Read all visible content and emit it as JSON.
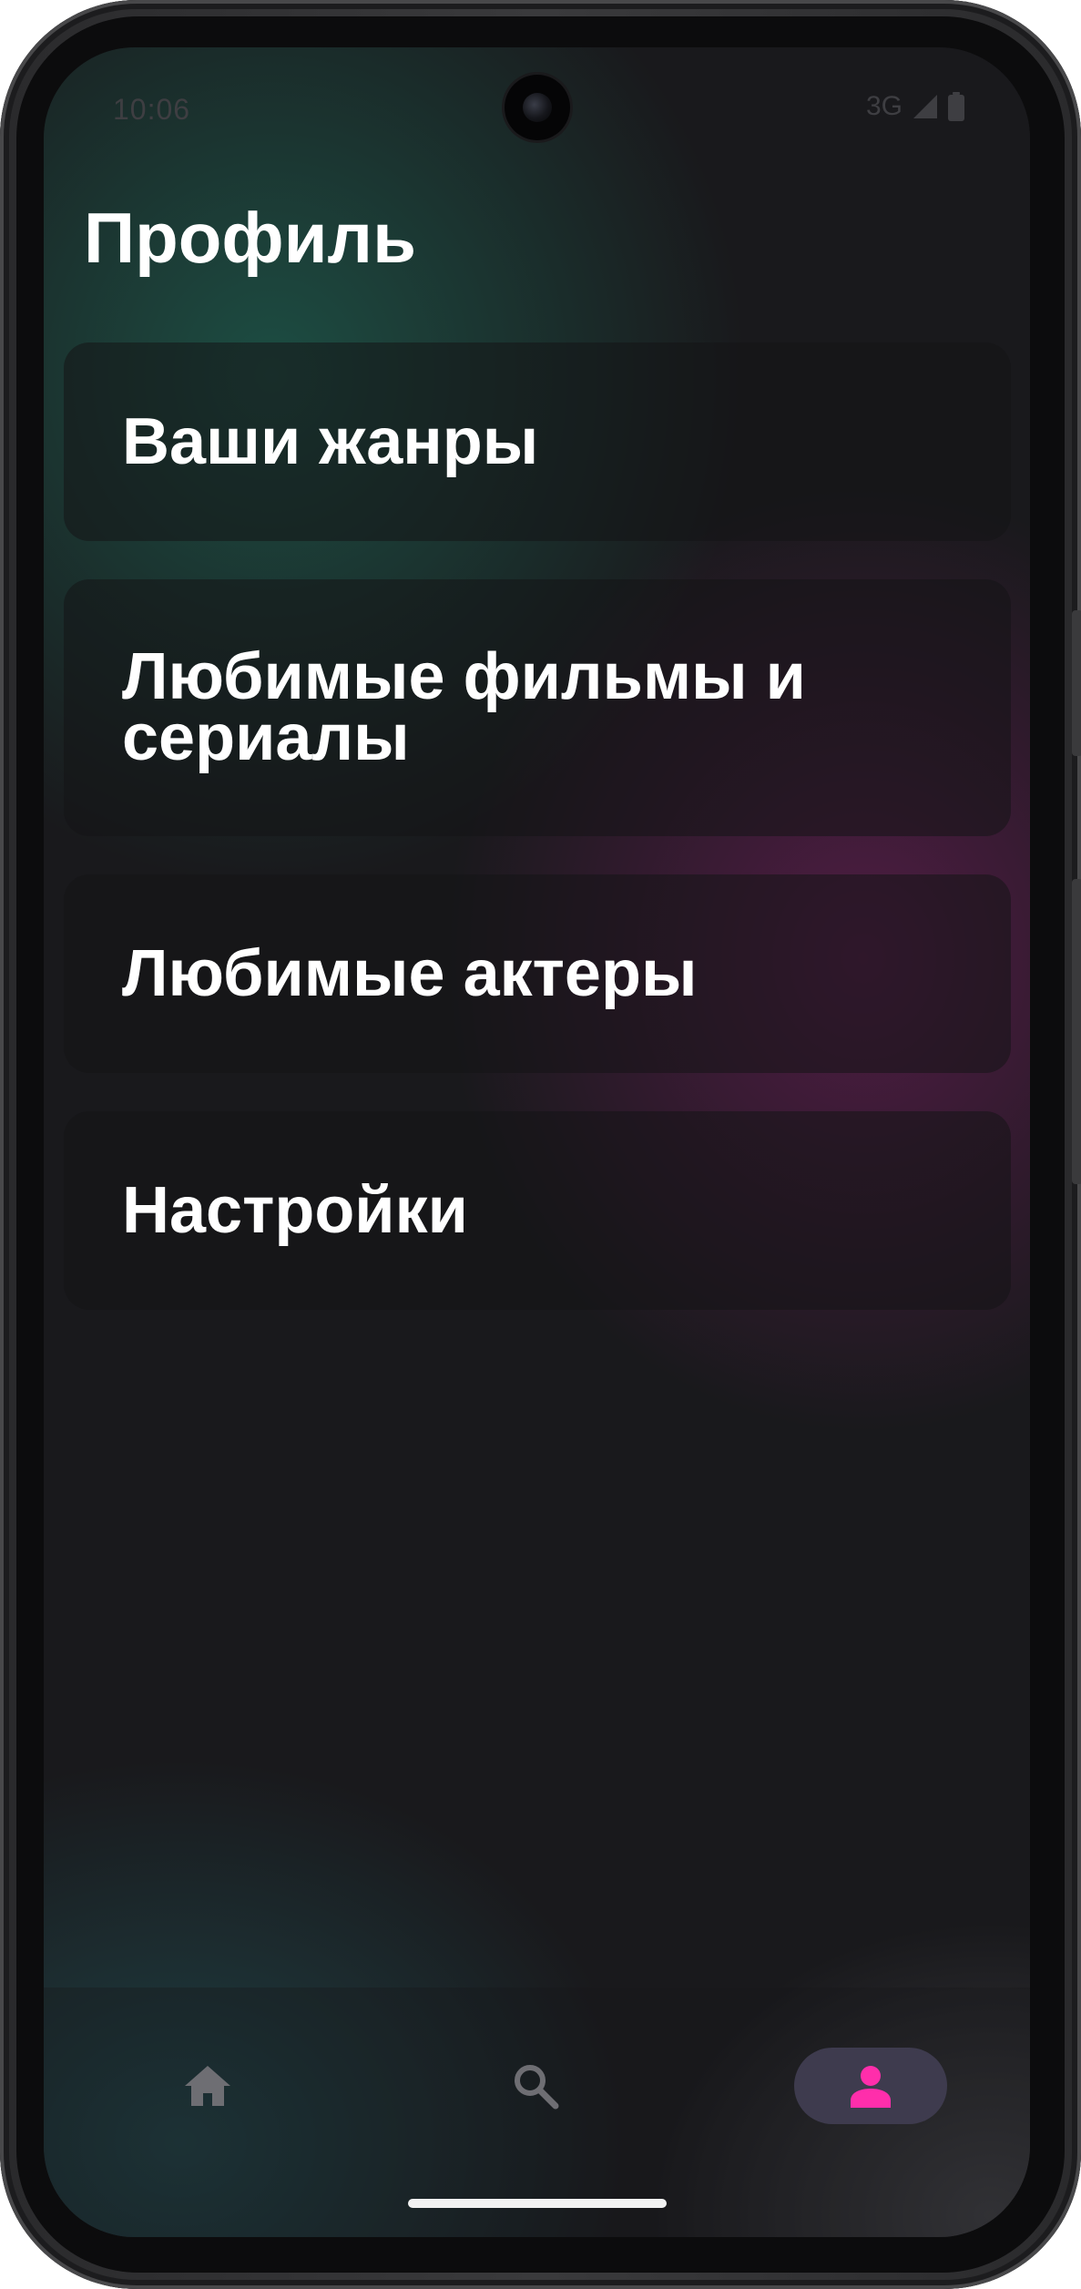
{
  "status_bar": {
    "time": "10:06",
    "network": "3G"
  },
  "header": {
    "title": "Профиль"
  },
  "menu": {
    "items": [
      {
        "label": "Ваши жанры"
      },
      {
        "label": "Любимые фильмы и сериалы"
      },
      {
        "label": "Любимые актеры"
      },
      {
        "label": "Настройки"
      }
    ]
  },
  "bottom_nav": {
    "items": [
      {
        "icon": "home-icon",
        "selected": false
      },
      {
        "icon": "search-icon",
        "selected": false
      },
      {
        "icon": "person-icon",
        "selected": true
      }
    ],
    "accent_color": "#FF2EAB",
    "inactive_color": "#6E6E73",
    "selected_pill_color": "#3E3B4E"
  }
}
